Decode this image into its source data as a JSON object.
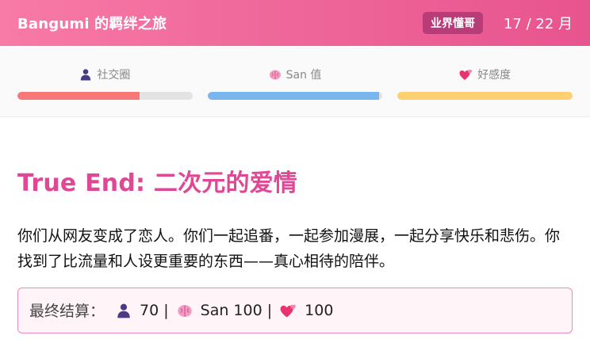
{
  "header": {
    "app_title": "Bangumi 的羁绊之旅",
    "badge": "业界懂哥",
    "progress": "17 / 22 月"
  },
  "stats": [
    {
      "icon": "person-icon",
      "label": "社交圈",
      "value_fraction": 0.7,
      "color": "#f87878"
    },
    {
      "icon": "brain-icon",
      "label": "San 值",
      "value_fraction": 0.98,
      "color": "#79b5ee"
    },
    {
      "icon": "two-hearts-icon",
      "label": "好感度",
      "value_fraction": 1.0,
      "color": "#fdd072"
    }
  ],
  "ending": {
    "title": "True End: 二次元的爱情",
    "description": "你们从网友变成了恋人。你们一起追番，一起参加漫展，一起分享快乐和悲伤。你找到了比流量和人设更重要的东西——真心相待的陪伴。",
    "summary_label": "最终结算：",
    "social_value": "70 |",
    "san_value": "San 100 |",
    "affection_value": "100"
  },
  "colors": {
    "accent": "#e04895",
    "header_gradient_start": "#f87aa6",
    "header_gradient_end": "#e8548e",
    "badge_bg": "#b83c78"
  }
}
